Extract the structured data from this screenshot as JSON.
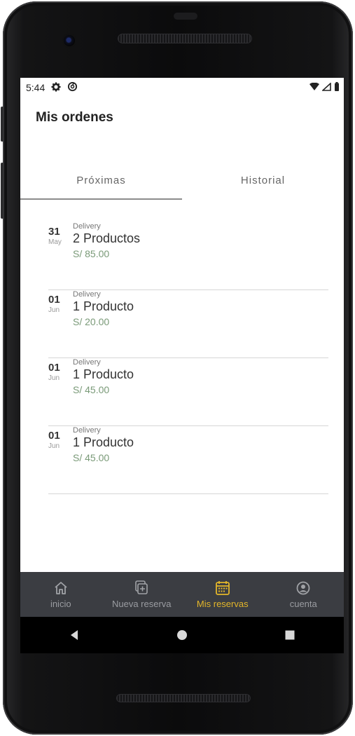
{
  "status": {
    "time": "5:44",
    "icons": [
      "gear-icon",
      "sync-icon",
      "wifi-icon",
      "signal-icon",
      "battery-icon"
    ]
  },
  "header": {
    "title": "Mis ordenes"
  },
  "tabs": [
    {
      "label": "Próximas",
      "active": true
    },
    {
      "label": "Historial",
      "active": false
    }
  ],
  "orders": [
    {
      "day": "31",
      "month": "May",
      "type": "Delivery",
      "products": "2 Productos",
      "price": "S/ 85.00"
    },
    {
      "day": "01",
      "month": "Jun",
      "type": "Delivery",
      "products": "1 Producto",
      "price": "S/ 20.00"
    },
    {
      "day": "01",
      "month": "Jun",
      "type": "Delivery",
      "products": "1 Producto",
      "price": "S/ 45.00"
    },
    {
      "day": "01",
      "month": "Jun",
      "type": "Delivery",
      "products": "1 Producto",
      "price": "S/ 45.00"
    }
  ],
  "navbar": {
    "items": [
      {
        "label": "inicio",
        "icon": "home-icon",
        "active": false
      },
      {
        "label": "Nueva reserva",
        "icon": "add-document-icon",
        "active": false
      },
      {
        "label": "Mis reservas",
        "icon": "calendar-icon",
        "active": true
      },
      {
        "label": "cuenta",
        "icon": "account-icon",
        "active": false
      }
    ]
  },
  "colors": {
    "accent": "#e3b62a",
    "navbar_bg": "#3b3d42",
    "price": "#7a9a78"
  }
}
